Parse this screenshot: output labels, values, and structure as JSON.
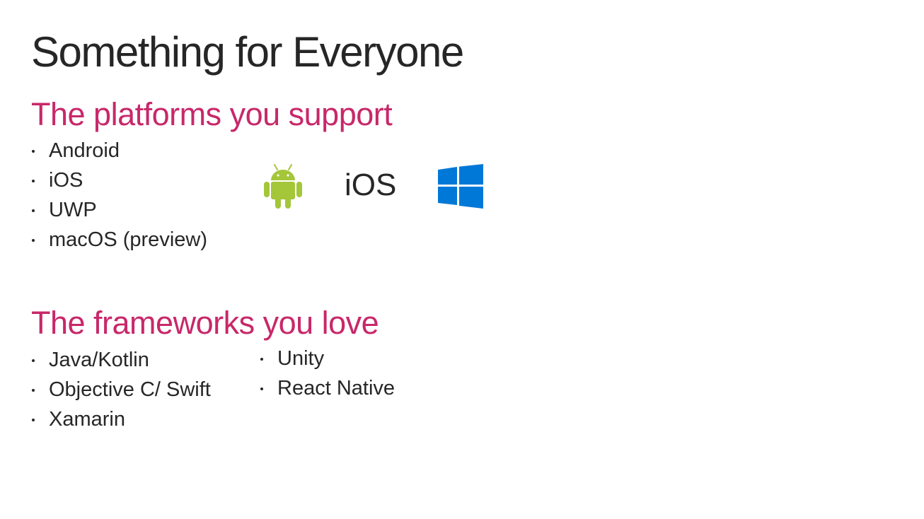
{
  "slide": {
    "title": "Something for Everyone"
  },
  "platforms": {
    "heading": "The platforms you support",
    "items": [
      {
        "label": "Android"
      },
      {
        "label": "iOS"
      },
      {
        "label": "UWP"
      },
      {
        "label": "macOS (preview)"
      }
    ],
    "logos": {
      "android_icon": "android-robot-logo",
      "ios_text": "iOS",
      "windows_icon": "windows-logo"
    }
  },
  "frameworks": {
    "heading": "The frameworks you love",
    "column1": [
      {
        "label": "Java/Kotlin"
      },
      {
        "label": "Objective C/ Swift"
      },
      {
        "label": "Xamarin"
      }
    ],
    "column2": [
      {
        "label": "Unity"
      },
      {
        "label": "React Native"
      }
    ]
  },
  "colors": {
    "heading_accent": "#c8286a",
    "text": "#262626",
    "android_green": "#a4c639",
    "windows_blue": "#0078d7"
  }
}
